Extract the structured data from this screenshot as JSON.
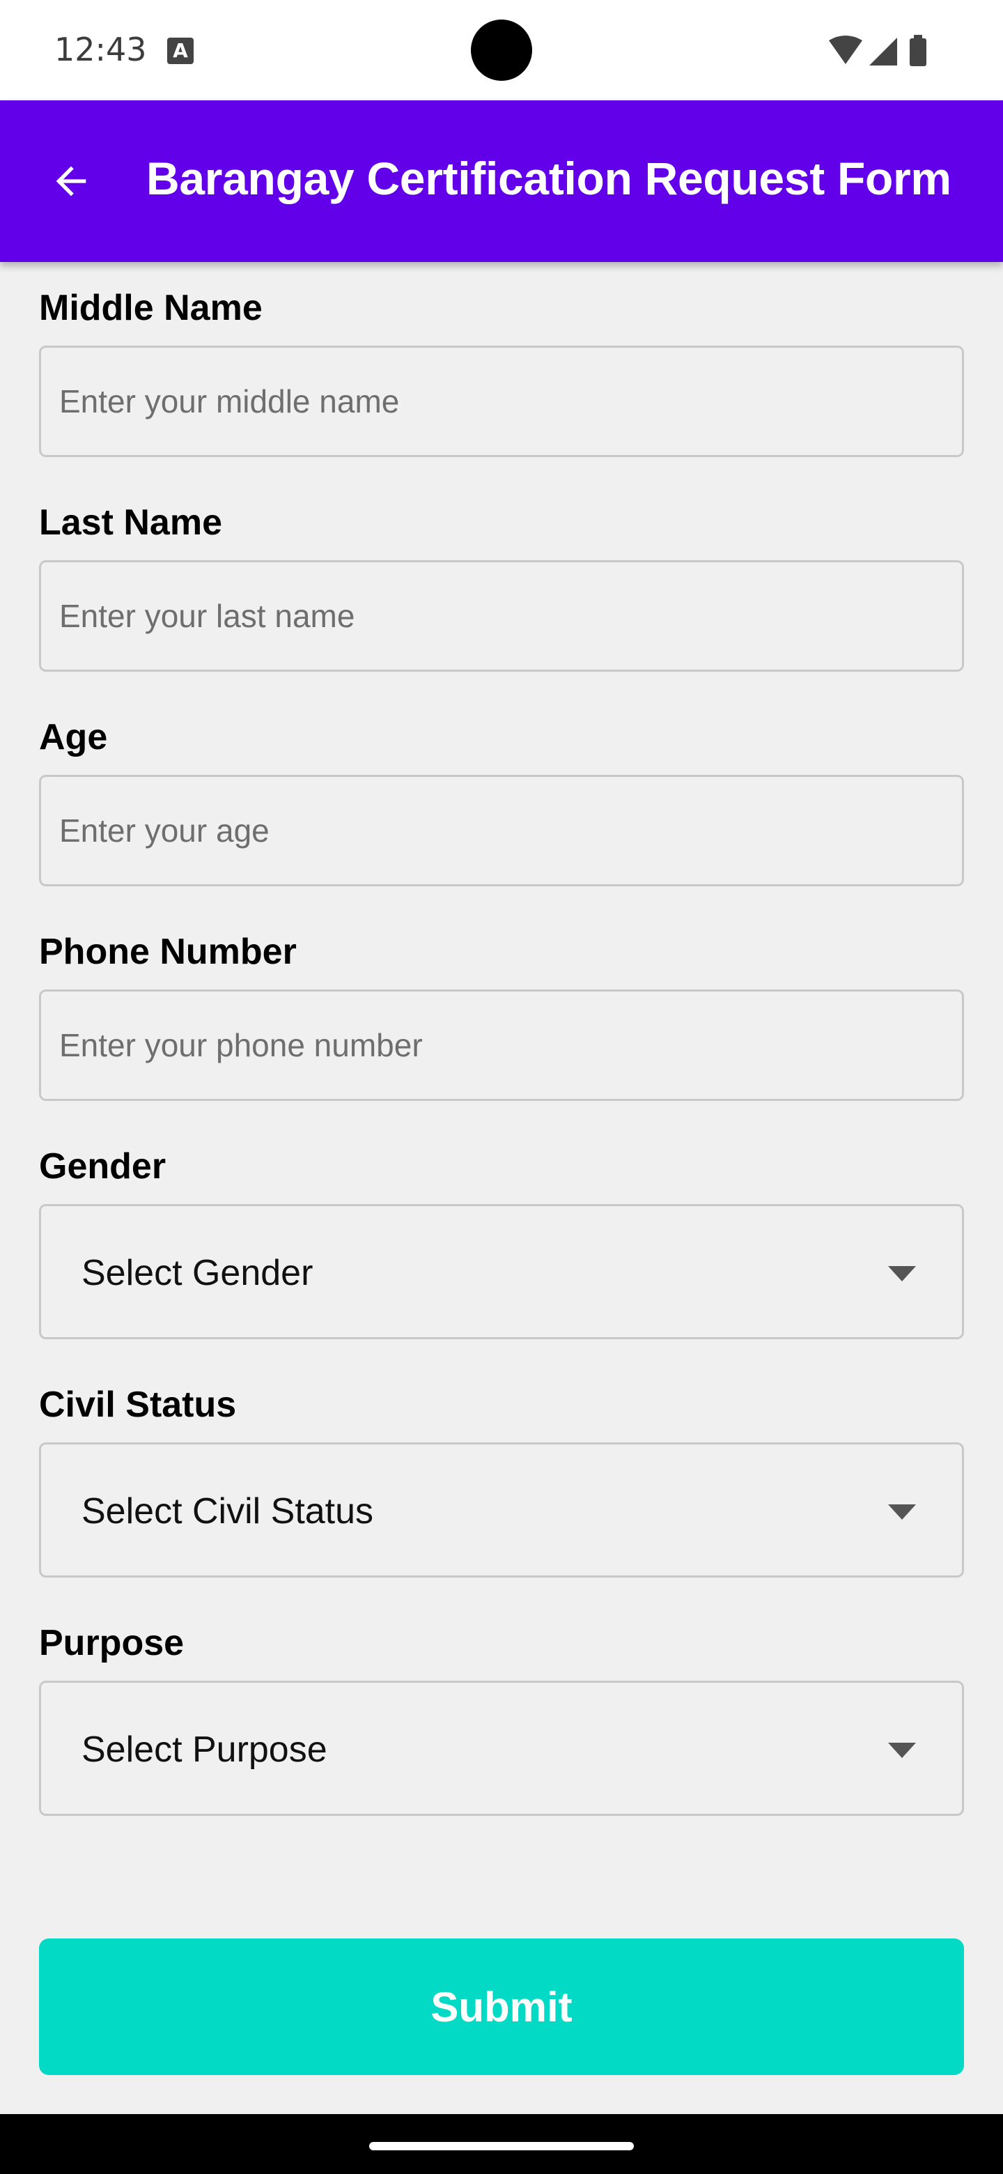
{
  "status_bar": {
    "time": "12:43",
    "notification_icon": "a-box-icon",
    "wifi_icon": "wifi-icon",
    "signal_icon": "cell-signal-icon",
    "battery_icon": "battery-icon"
  },
  "app_bar": {
    "back_icon": "arrow-left-icon",
    "title": "Barangay Certification Request Form",
    "background_color": "#6200ea"
  },
  "form": {
    "middle_name": {
      "label": "Middle Name",
      "placeholder": "Enter your middle name",
      "value": ""
    },
    "last_name": {
      "label": "Last Name",
      "placeholder": "Enter your last name",
      "value": ""
    },
    "age": {
      "label": "Age",
      "placeholder": "Enter your age",
      "value": ""
    },
    "phone_number": {
      "label": "Phone Number",
      "placeholder": "Enter your phone number",
      "value": ""
    },
    "gender": {
      "label": "Gender",
      "selected": "Select Gender"
    },
    "civil_status": {
      "label": "Civil Status",
      "selected": "Select Civil Status"
    },
    "purpose": {
      "label": "Purpose",
      "selected": "Select Purpose"
    },
    "submit_label": "Submit",
    "submit_color": "#03dac5"
  }
}
